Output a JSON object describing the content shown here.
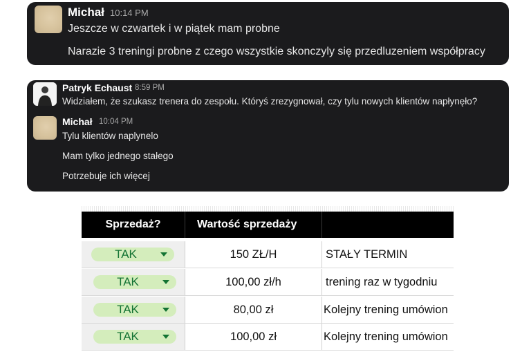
{
  "chat1": {
    "name": "Michał",
    "time": "10:14 PM",
    "messages": [
      "Jeszcze w czwartek i w piątek mam probne",
      "Narazie 3 treningi probne z czego wszystkie skonczyly się przedluzeniem współpracy"
    ]
  },
  "chat2": {
    "first": {
      "name": "Patryk Echaust",
      "time": "8:59 PM",
      "message": "Widziałem, że szukasz trenera do zespołu. Któryś zrezygnował, czy tylu nowych klientów napłynęło?"
    },
    "second": {
      "name": "Michał",
      "time": "10:04 PM",
      "messages": [
        "Tylu klientów naplynelo",
        "Mam tylko jednego stałego",
        "Potrzebuje ich więcej"
      ]
    }
  },
  "sheet": {
    "headers": [
      "Sprzedaż?",
      "Wartość sprzedaży",
      ""
    ],
    "rows": [
      {
        "status": "TAK",
        "value": "150 ZŁ/H",
        "note": "STAŁY TERMIN"
      },
      {
        "status": "TAK",
        "value": "100,00 zł/h",
        "note": "trening raz w tygodniu"
      },
      {
        "status": "TAK",
        "value": "80,00 zł",
        "note": "Kolejny trening umówion"
      },
      {
        "status": "TAK",
        "value": "100,00 zł",
        "note": "Kolejny trening umówion"
      }
    ],
    "colors": {
      "chip_bg": "#d4edbc",
      "chip_text": "#137333",
      "header_bg": "#000000"
    }
  }
}
